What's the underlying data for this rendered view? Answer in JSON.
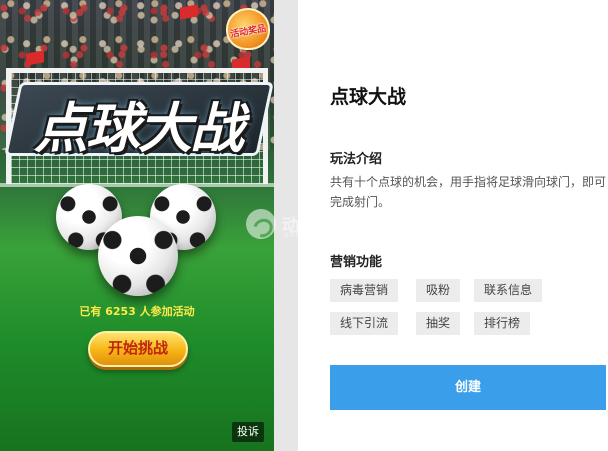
{
  "preview": {
    "badge_text": "活动奖品",
    "game_title": "点球大战",
    "participants_text": "已有 6253 人参加活动",
    "start_label": "开始挑战",
    "report_label": "投诉"
  },
  "watermark": {
    "name": "动乐互动",
    "sub": "DONGLE HUDONG"
  },
  "info": {
    "title": "点球大战",
    "intro_heading": "玩法介绍",
    "intro_text": "共有十个点球的机会，用手指将足球滑向球门，即可完成射门。",
    "marketing_heading": "营销功能",
    "tags": [
      "病毒营销",
      "吸粉",
      "联系信息",
      "线下引流",
      "抽奖",
      "排行榜"
    ],
    "create_label": "创建"
  },
  "colors": {
    "accent": "#3a9eea",
    "tag_bg": "#ececec",
    "start_button": "#f6b416",
    "participants_text": "#ffe94a"
  }
}
